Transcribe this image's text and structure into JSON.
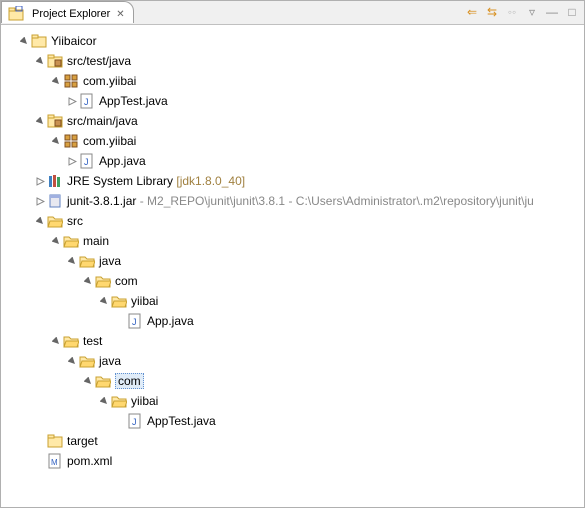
{
  "tab": {
    "title": "Project Explorer"
  },
  "toolbar": {
    "collapse": "⇐",
    "link": "⇆",
    "menu": "▿",
    "min": "—",
    "max": "□"
  },
  "tree": {
    "project": "Yiibaicor",
    "srcTestJava": "src/test/java",
    "pkgYiibai": "com.yiibai",
    "appTestJava": "AppTest.java",
    "srcMainJava": "src/main/java",
    "appJava": "App.java",
    "jre": "JRE System Library",
    "jreVer": " [jdk1.8.0_40]",
    "junit": "junit-3.8.1.jar",
    "junitPath": " - M2_REPO\\junit\\junit\\3.8.1 - C:\\Users\\Administrator\\.m2\\repository\\junit\\ju",
    "src": "src",
    "main": "main",
    "java": "java",
    "com": "com",
    "yiibai": "yiibai",
    "test": "test",
    "target": "target",
    "pom": "pom.xml"
  }
}
